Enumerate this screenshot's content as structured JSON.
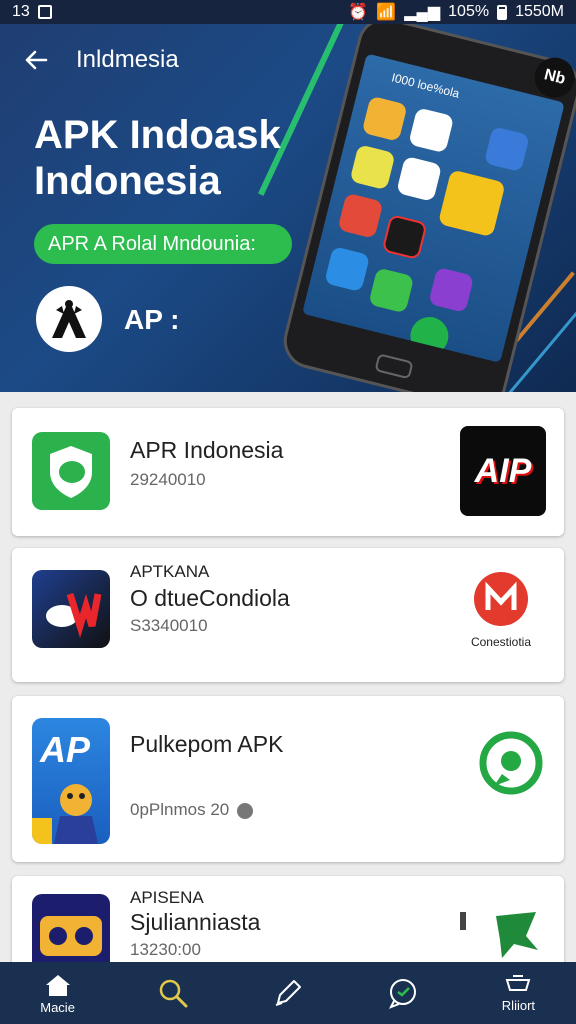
{
  "status_bar": {
    "time_left": "13",
    "battery": "105%",
    "time_right": "1550M"
  },
  "header": {
    "back_label": "←",
    "title": "Inldmesia"
  },
  "hero": {
    "title": "APK Indoask Indonesia",
    "pill_label": "APR A Rolal Mndounia:",
    "logo_label": "AP :",
    "phone_screen_text": "I000 loe%ola",
    "phone_badge": "Nb"
  },
  "apps": [
    {
      "sub": "",
      "name": "APR Indonesia",
      "meta": "29240010",
      "brand_text": "AIP"
    },
    {
      "sub": "APTKANA",
      "name": "O dtueCondiola",
      "meta": "S3340010",
      "brand_text": "Conestiotia"
    },
    {
      "sub": "",
      "name": "Pulkepom APK",
      "meta": "0pPlnmos 20",
      "brand_text": ""
    },
    {
      "sub": "APISENA",
      "name": "Sjulianniasta",
      "meta": "13230:00",
      "brand_text": ""
    }
  ],
  "bottom_nav": [
    {
      "label": "Macie",
      "icon": "home-icon"
    },
    {
      "label": "",
      "icon": "search-icon"
    },
    {
      "label": "",
      "icon": "pen-icon"
    },
    {
      "label": "",
      "icon": "chat-icon"
    },
    {
      "label": "Rliiort",
      "icon": "cart-icon"
    }
  ],
  "colors": {
    "hero": "#1c4a86",
    "accent_green": "#2dbd4f",
    "nav": "#1a3050"
  }
}
